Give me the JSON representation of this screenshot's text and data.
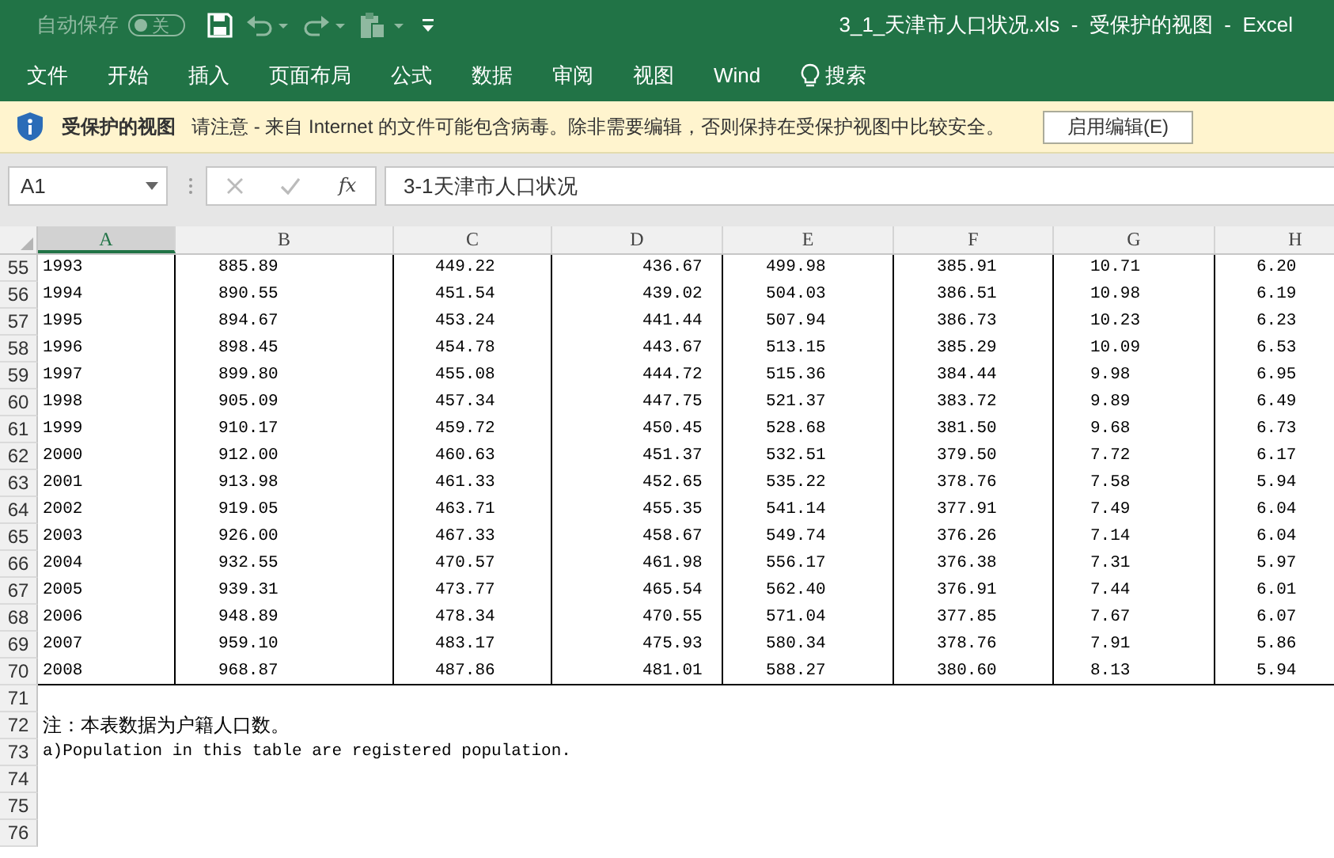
{
  "title_bar": {
    "autosave_label": "自动保存",
    "autosave_on": false,
    "autosave_state": "关",
    "title": "3_1_天津市人口状况.xls  -  受保护的视图  -  Excel"
  },
  "ribbon": {
    "tabs": [
      "文件",
      "开始",
      "插入",
      "页面布局",
      "公式",
      "数据",
      "审阅",
      "视图",
      "Wind"
    ],
    "search": "搜索"
  },
  "protected_bar": {
    "title": "受保护的视图",
    "message": "请注意 - 来自 Internet 的文件可能包含病毒。除非需要编辑，否则保持在受保护视图中比较安全。",
    "button": "启用编辑(E)"
  },
  "formula_bar": {
    "name_box": "A1",
    "function_symbol": "fx",
    "content": "3-1天津市人口状况"
  },
  "sheet": {
    "columns": [
      {
        "label": "A",
        "selected": true
      },
      {
        "label": "B",
        "selected": false
      },
      {
        "label": "C",
        "selected": false
      },
      {
        "label": "D",
        "selected": false
      },
      {
        "label": "E",
        "selected": false
      },
      {
        "label": "F",
        "selected": false
      },
      {
        "label": "G",
        "selected": false
      },
      {
        "label": "H",
        "selected": false
      }
    ],
    "rows": [
      {
        "number": "55",
        "kind": "data",
        "cells": [
          "1993",
          "885.89",
          "449.22",
          "436.67",
          "499.98",
          "385.91",
          "10.71",
          "6.20"
        ]
      },
      {
        "number": "56",
        "kind": "data",
        "cells": [
          "1994",
          "890.55",
          "451.54",
          "439.02",
          "504.03",
          "386.51",
          "10.98",
          "6.19"
        ]
      },
      {
        "number": "57",
        "kind": "data",
        "cells": [
          "1995",
          "894.67",
          "453.24",
          "441.44",
          "507.94",
          "386.73",
          "10.23",
          "6.23"
        ]
      },
      {
        "number": "58",
        "kind": "data",
        "cells": [
          "1996",
          "898.45",
          "454.78",
          "443.67",
          "513.15",
          "385.29",
          "10.09",
          "6.53"
        ]
      },
      {
        "number": "59",
        "kind": "data",
        "cells": [
          "1997",
          "899.80",
          "455.08",
          "444.72",
          "515.36",
          "384.44",
          "9.98",
          "6.95"
        ]
      },
      {
        "number": "60",
        "kind": "data",
        "cells": [
          "1998",
          "905.09",
          "457.34",
          "447.75",
          "521.37",
          "383.72",
          "9.89",
          "6.49"
        ]
      },
      {
        "number": "61",
        "kind": "data",
        "cells": [
          "1999",
          "910.17",
          "459.72",
          "450.45",
          "528.68",
          "381.50",
          "9.68",
          "6.73"
        ]
      },
      {
        "number": "62",
        "kind": "data",
        "cells": [
          "2000",
          "912.00",
          "460.63",
          "451.37",
          "532.51",
          "379.50",
          "7.72",
          "6.17"
        ]
      },
      {
        "number": "63",
        "kind": "data",
        "cells": [
          "2001",
          "913.98",
          "461.33",
          "452.65",
          "535.22",
          "378.76",
          "7.58",
          "5.94"
        ]
      },
      {
        "number": "64",
        "kind": "data",
        "cells": [
          "2002",
          "919.05",
          "463.71",
          "455.35",
          "541.14",
          "377.91",
          "7.49",
          "6.04"
        ]
      },
      {
        "number": "65",
        "kind": "data",
        "cells": [
          "2003",
          "926.00",
          "467.33",
          "458.67",
          "549.74",
          "376.26",
          "7.14",
          "6.04"
        ]
      },
      {
        "number": "66",
        "kind": "data",
        "cells": [
          "2004",
          "932.55",
          "470.57",
          "461.98",
          "556.17",
          "376.38",
          "7.31",
          "5.97"
        ]
      },
      {
        "number": "67",
        "kind": "data",
        "cells": [
          "2005",
          "939.31",
          "473.77",
          "465.54",
          "562.40",
          "376.91",
          "7.44",
          "6.01"
        ]
      },
      {
        "number": "68",
        "kind": "data",
        "cells": [
          "2006",
          "948.89",
          "478.34",
          "470.55",
          "571.04",
          "377.85",
          "7.67",
          "6.07"
        ]
      },
      {
        "number": "69",
        "kind": "data",
        "cells": [
          "2007",
          "959.10",
          "483.17",
          "475.93",
          "580.34",
          "378.76",
          "7.91",
          "5.86"
        ]
      },
      {
        "number": "70",
        "kind": "data",
        "cells": [
          "2008",
          "968.87",
          "487.86",
          "481.01",
          "588.27",
          "380.60",
          "8.13",
          "5.94"
        ]
      },
      {
        "number": "71",
        "kind": "blank"
      },
      {
        "number": "72",
        "kind": "note",
        "text": "注：本表数据为户籍人口数。"
      },
      {
        "number": "73",
        "kind": "note_en",
        "text": "a)Population in this table are registered population."
      },
      {
        "number": "74",
        "kind": "blank"
      },
      {
        "number": "75",
        "kind": "blank"
      },
      {
        "number": "76",
        "kind": "blank"
      }
    ]
  }
}
